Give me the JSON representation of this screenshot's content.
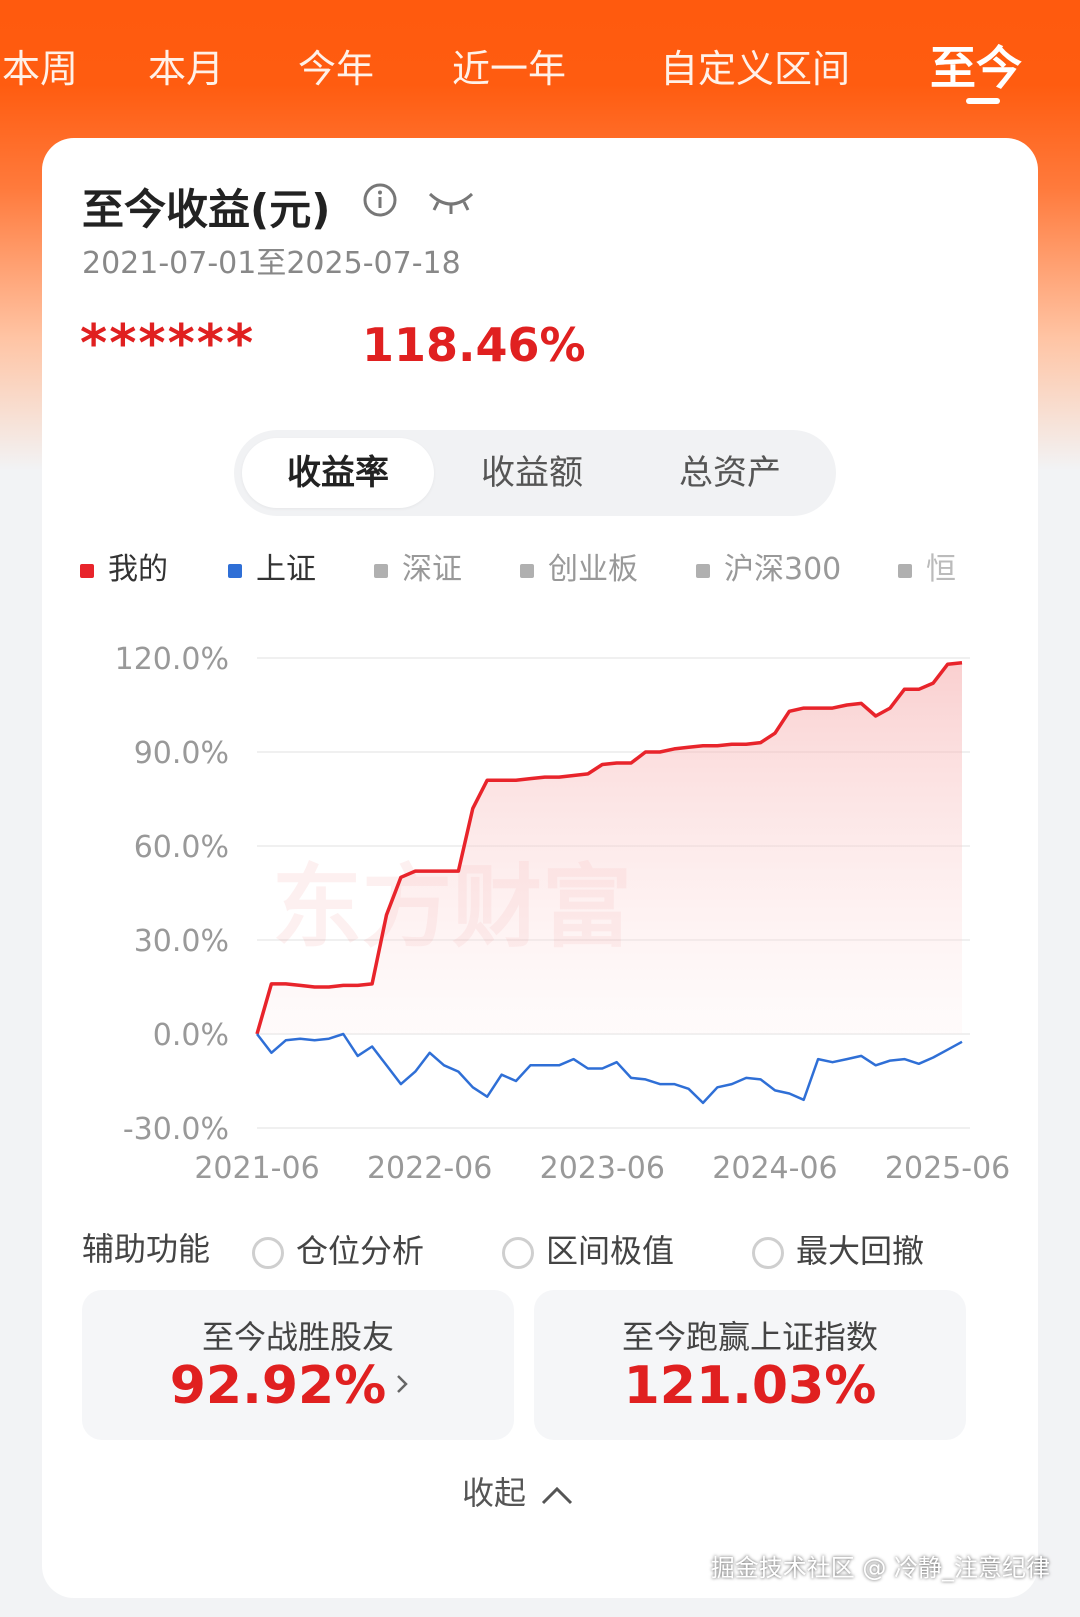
{
  "tabs": [
    "本周",
    "本月",
    "今年",
    "近一年",
    "自定义区间",
    "至今"
  ],
  "card": {
    "title": "至今收益(元)",
    "date_range": "2021-07-01至2025-07-18",
    "masked_amount": "******",
    "return_pct": "118.46%"
  },
  "segments": [
    "收益率",
    "收益额",
    "总资产"
  ],
  "legend": [
    {
      "label": "我的",
      "color": "#e8242b"
    },
    {
      "label": "上证",
      "color": "#2f6fd6"
    },
    {
      "label": "深证",
      "color": "#b0b0b0"
    },
    {
      "label": "创业板",
      "color": "#b0b0b0"
    },
    {
      "label": "沪深300",
      "color": "#b0b0b0"
    },
    {
      "label": "恒",
      "color": "#b0b0b0"
    }
  ],
  "chart_data": {
    "type": "area",
    "x": [
      "2021-06",
      "2021-07",
      "2021-08",
      "2021-09",
      "2021-10",
      "2021-11",
      "2021-12",
      "2022-01",
      "2022-02",
      "2022-03",
      "2022-04",
      "2022-05",
      "2022-06",
      "2022-07",
      "2022-08",
      "2022-09",
      "2022-10",
      "2022-11",
      "2022-12",
      "2023-01",
      "2023-02",
      "2023-03",
      "2023-04",
      "2023-05",
      "2023-06",
      "2023-07",
      "2023-08",
      "2023-09",
      "2023-10",
      "2023-11",
      "2023-12",
      "2024-01",
      "2024-02",
      "2024-03",
      "2024-04",
      "2024-05",
      "2024-06",
      "2024-07",
      "2024-08",
      "2024-09",
      "2024-10",
      "2024-11",
      "2024-12",
      "2025-01",
      "2025-02",
      "2025-03",
      "2025-04",
      "2025-05",
      "2025-06",
      "2025-07"
    ],
    "series": [
      {
        "name": "我的",
        "color": "#e8242b",
        "values": [
          0,
          16,
          16,
          15.5,
          15,
          15,
          15.5,
          15.5,
          16,
          38,
          50,
          52,
          52,
          52,
          52,
          72,
          81,
          81,
          81,
          81.5,
          82,
          82,
          82.5,
          83,
          86,
          86.5,
          86.5,
          90,
          90,
          91,
          91.5,
          92,
          92,
          92.5,
          92.5,
          93,
          96,
          103,
          104,
          104,
          104,
          105,
          105.5,
          101.5,
          104,
          110,
          110,
          112,
          118,
          118.5
        ]
      },
      {
        "name": "上证",
        "color": "#2f6fd6",
        "values": [
          0,
          -6,
          -2,
          -1.5,
          -2,
          -1.5,
          0,
          -7,
          -4,
          -10,
          -16,
          -12,
          -6,
          -10,
          -12,
          -17,
          -20,
          -13,
          -15,
          -10,
          -10,
          -10,
          -8,
          -11,
          -11,
          -9,
          -14,
          -14.5,
          -16,
          -16,
          -17.5,
          -22,
          -17,
          -16,
          -14,
          -14.5,
          -18,
          -19,
          -21,
          -8,
          -9,
          -8,
          -7,
          -10,
          -8.5,
          -8,
          -9.5,
          -7.5,
          -5,
          -2.5
        ]
      }
    ],
    "ylim": [
      -30,
      120
    ],
    "yticks": [
      "120.0%",
      "90.0%",
      "60.0%",
      "30.0%",
      "0.0%",
      "-30.0%"
    ],
    "xticks": [
      "2021-06",
      "2022-06",
      "2023-06",
      "2024-06",
      "2025-06"
    ],
    "grid": true,
    "watermark": "东方财富"
  },
  "aux": {
    "label": "辅助功能",
    "options": [
      "仓位分析",
      "区间极值",
      "最大回撤"
    ]
  },
  "stats": [
    {
      "label": "至今战胜股友",
      "value": "92.92%"
    },
    {
      "label": "至今跑赢上证指数",
      "value": "121.03%"
    }
  ],
  "collapse_label": "收起",
  "footer_watermark": "掘金技术社区 @ 冷静_注意纪律"
}
